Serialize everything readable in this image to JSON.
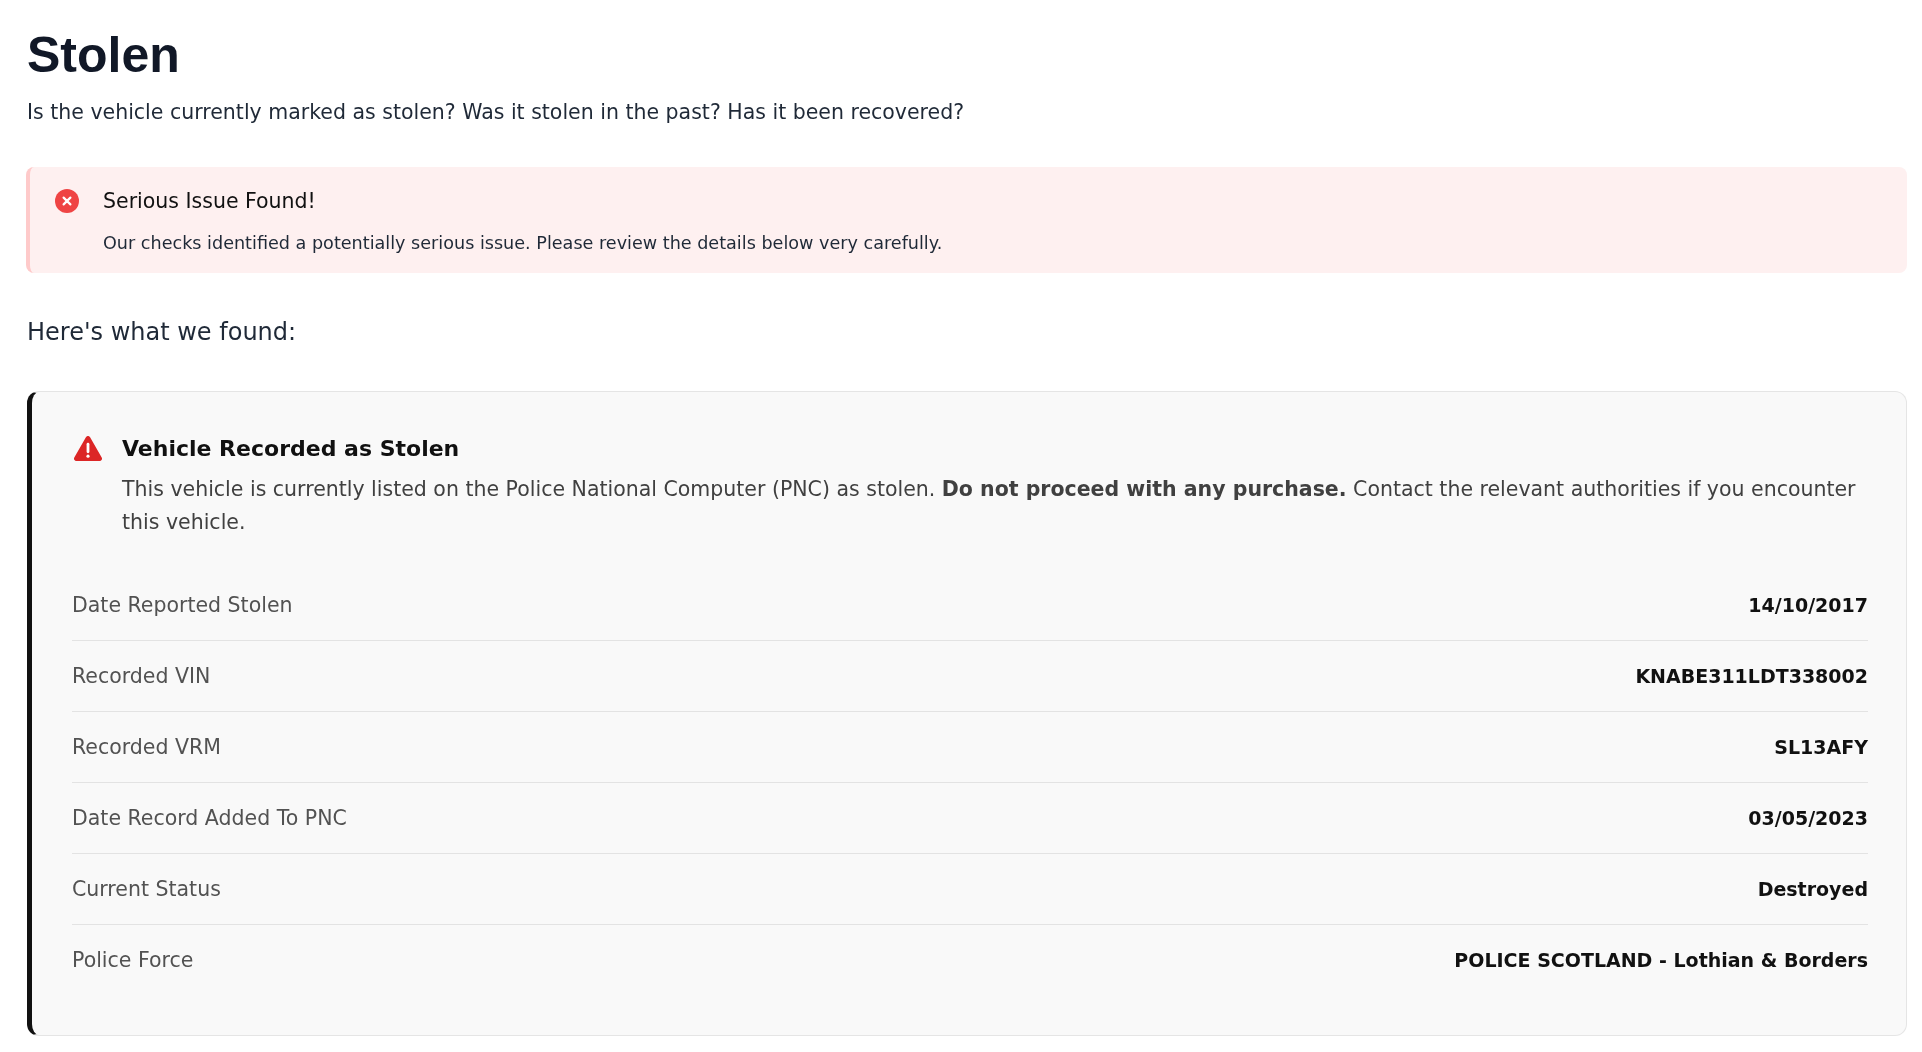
{
  "header": {
    "title": "Stolen",
    "subtitle": "Is the vehicle currently marked as stolen? Was it stolen in the past? Has it been recovered?"
  },
  "alert": {
    "kind": "error",
    "title": "Serious Issue Found!",
    "message": "Our checks identified a potentially serious issue. Please review the details below very carefully."
  },
  "findings_heading": "Here's what we found:",
  "findings": [
    {
      "kind": "warning",
      "title": "Vehicle Recorded as Stolen",
      "description": "This vehicle is currently listed on the Police National Computer (PNC) as stolen. **Do not proceed with any purchase.** Contact the relevant authorities if you encounter this vehicle.",
      "details": [
        {
          "label": "Date Reported Stolen",
          "value": "14/10/2017"
        },
        {
          "label": "Recorded VIN",
          "value": "KNABE311LDT338002"
        },
        {
          "label": "Recorded VRM",
          "value": "SL13AFY"
        },
        {
          "label": "Date Record Added To PNC",
          "value": "03/05/2023"
        },
        {
          "label": "Current Status",
          "value": "Destroyed"
        },
        {
          "label": "Police Force",
          "value": "POLICE SCOTLAND - Lothian & Borders"
        }
      ]
    }
  ]
}
